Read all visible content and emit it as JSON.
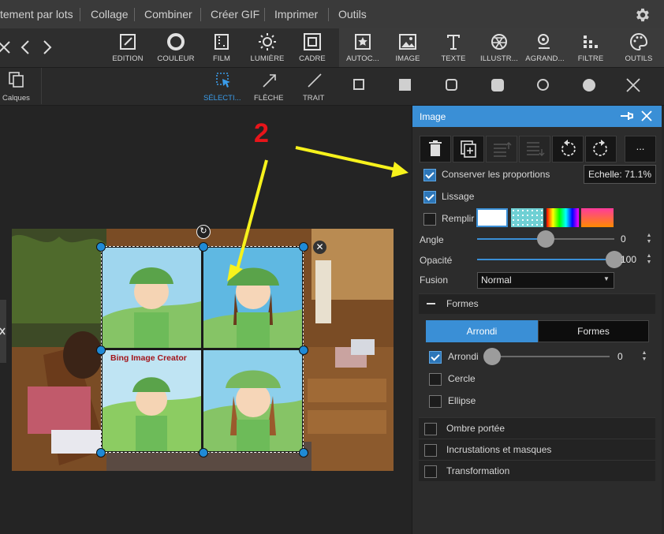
{
  "menubar": {
    "items": [
      "tement par lots",
      "Collage",
      "Combiner",
      "Créer GIF",
      "Imprimer",
      "Outils"
    ]
  },
  "toolbar": {
    "tools": [
      "EDITION",
      "COULEUR",
      "FILM",
      "LUMIÈRE",
      "CADRE",
      "AUTOC...",
      "IMAGE",
      "TEXTE",
      "ILLUSTR...",
      "AGRAND...",
      "FILTRE",
      "OUTILS"
    ]
  },
  "subbar": {
    "layers_label": "Calques",
    "select_label": "SÉLECTI...",
    "arrow_label": "FLÈCHE",
    "line_label": "TRAIT"
  },
  "canvas": {
    "annotation_number": "2",
    "collage_caption": "Bing Image Creator"
  },
  "panel": {
    "title": "Image",
    "more_label": "...",
    "keep_ratio_label": "Conserver les proportions",
    "keep_ratio_checked": true,
    "scale_label": "Echelle: 71.1%",
    "smooth_label": "Lissage",
    "smooth_checked": true,
    "fill_label": "Remplir",
    "fill_checked": false,
    "angle_label": "Angle",
    "angle_value": "0",
    "angle_fraction": 0.5,
    "opacity_label": "Opacité",
    "opacity_value": "100",
    "opacity_fraction": 1.0,
    "blend_label": "Fusion",
    "blend_value": "Normal",
    "shapes_section": "Formes",
    "tab_rounded": "Arrondi",
    "tab_shapes": "Formes",
    "rounded_label": "Arrondi",
    "rounded_checked": true,
    "rounded_value": "0",
    "circle_label": "Cercle",
    "ellipse_label": "Ellipse",
    "shadow_label": "Ombre portée",
    "inlays_label": "Incrustations et masques",
    "transform_label": "Transformation",
    "accent_color": "#3a8fd6",
    "annotation_arrow_color": "#f7f21c",
    "annotation_number_color": "#e8141a"
  }
}
